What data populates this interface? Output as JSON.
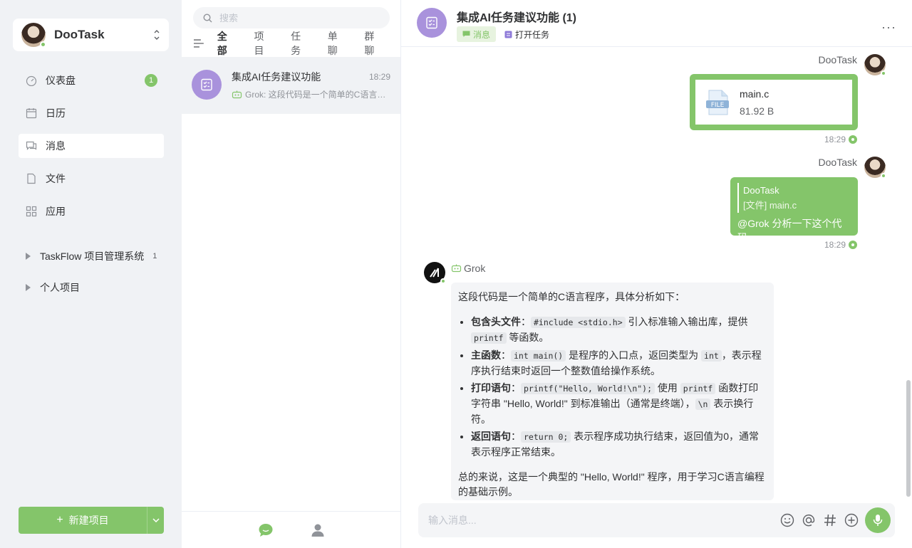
{
  "sidebar": {
    "team_name": "DooTask",
    "menu": [
      {
        "label": "仪表盘",
        "badge": "1"
      },
      {
        "label": "日历"
      },
      {
        "label": "消息"
      },
      {
        "label": "文件"
      },
      {
        "label": "应用"
      }
    ],
    "projects": [
      {
        "label": "TaskFlow 项目管理系统",
        "count": "1"
      },
      {
        "label": "个人项目"
      }
    ],
    "new_project_label": "新建项目"
  },
  "dialog_list": {
    "search_placeholder": "搜索",
    "tabs": [
      "全部",
      "项目",
      "任务",
      "单聊",
      "群聊"
    ],
    "items": [
      {
        "title": "集成AI任务建议功能",
        "time": "18:29",
        "preview": "Grok: 这段代码是一个简单的C语言程序，具体分析如下"
      }
    ]
  },
  "chat": {
    "title": "集成AI任务建议功能 (1)",
    "tag_message": "消息",
    "tag_open_task": "打开任务",
    "messages": {
      "file_msg": {
        "sender": "DooTask",
        "file_name": "main.c",
        "file_size": "81.92 B",
        "time": "18:29"
      },
      "reply_msg": {
        "sender": "DooTask",
        "quote_sender": "DooTask",
        "quote_text": "[文件] main.c",
        "text": "@Grok 分析一下这个代码",
        "time": "18:29"
      },
      "grok_msg": {
        "sender": "Grok",
        "intro": "这段代码是一个简单的C语言程序，具体分析如下：",
        "points": [
          {
            "title": "包含头文件",
            "parts": [
              "：",
              "#include <stdio.h>",
              " 引入标准输入输出库，提供 ",
              "printf",
              " 等函数。"
            ]
          },
          {
            "title": "主函数",
            "parts": [
              "：",
              "int main()",
              " 是程序的入口点，返回类型为 ",
              "int",
              "，表示程序执行结束时返回一个整数值给操作系统。"
            ]
          },
          {
            "title": "打印语句",
            "parts": [
              "：",
              "printf(\"Hello, World!\\n\");",
              " 使用 ",
              "printf",
              " 函数打印字符串 \"Hello, World!\" 到标准输出（通常是终端），",
              "\\n",
              " 表示换行符。"
            ]
          },
          {
            "title": "返回语句",
            "parts": [
              "：",
              "return 0;",
              " 表示程序成功执行结束，返回值为0，通常表示程序正常结束。"
            ]
          }
        ],
        "summary": "总的来说，这是一个典型的 \"Hello, World!\" 程序，用于学习C语言编程的基础示例。"
      }
    },
    "input_placeholder": "输入消息..."
  },
  "colors": {
    "accent": "#84c56a",
    "dialog_icon": "#a992dc",
    "sidebar_bg": "#f0f2f5"
  }
}
